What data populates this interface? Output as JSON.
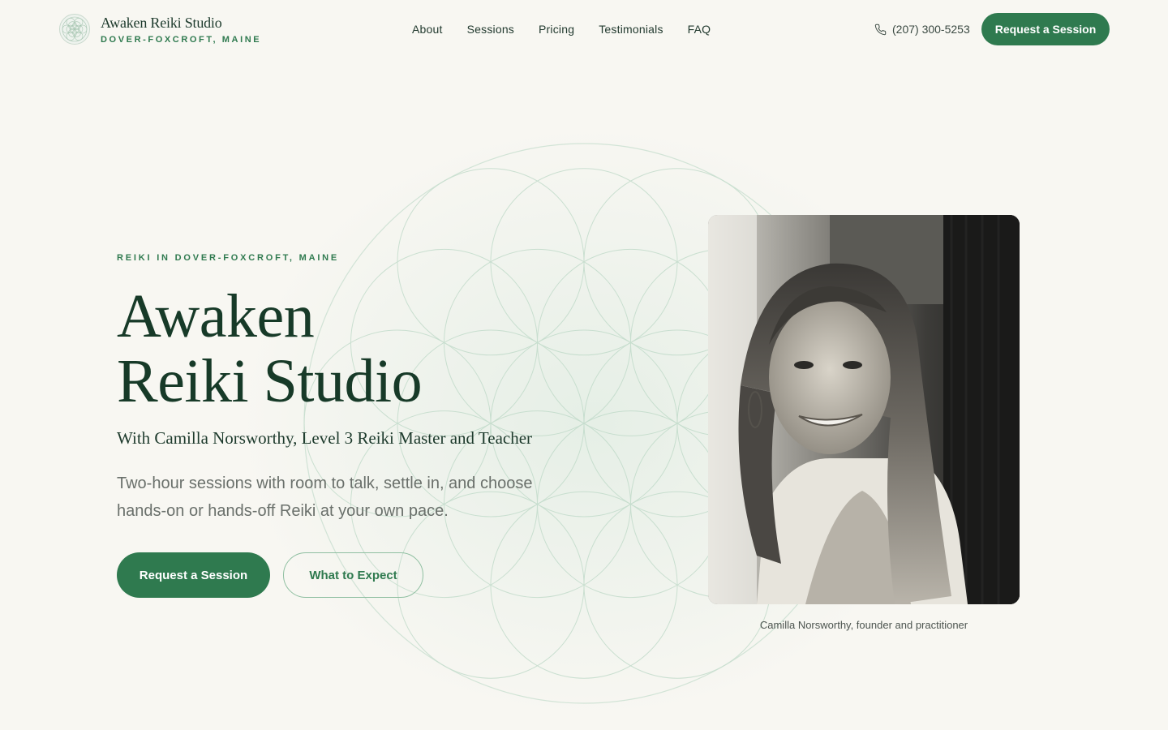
{
  "brand": {
    "name": "Awaken Reiki Studio",
    "location": "DOVER-FOXCROFT, MAINE",
    "logo_icon": "flower-of-life-icon"
  },
  "nav": {
    "items": [
      {
        "label": "About"
      },
      {
        "label": "Sessions"
      },
      {
        "label": "Pricing"
      },
      {
        "label": "Testimonials"
      },
      {
        "label": "FAQ"
      }
    ]
  },
  "header": {
    "phone_icon": "phone-icon",
    "phone": "(207) 300-5253",
    "cta_label": "Request a Session"
  },
  "hero": {
    "eyebrow": "REIKI IN DOVER-FOXCROFT, MAINE",
    "title_line1": "Awaken",
    "title_line2": "Reiki Studio",
    "subtitle": "With Camilla Norsworthy, Level 3 Reiki Master and Teacher",
    "lede": "Two-hour sessions with room to talk, settle in, and choose hands-on or hands-off Reiki at your own pace.",
    "primary_cta": "Request a Session",
    "secondary_cta": "What to Expect",
    "photo_caption": "Camilla Norsworthy, founder and practitioner"
  },
  "colors": {
    "accent": "#2f7a4f",
    "background": "#f8f7f2",
    "heading": "#173a28",
    "body_text": "#6a706b"
  }
}
